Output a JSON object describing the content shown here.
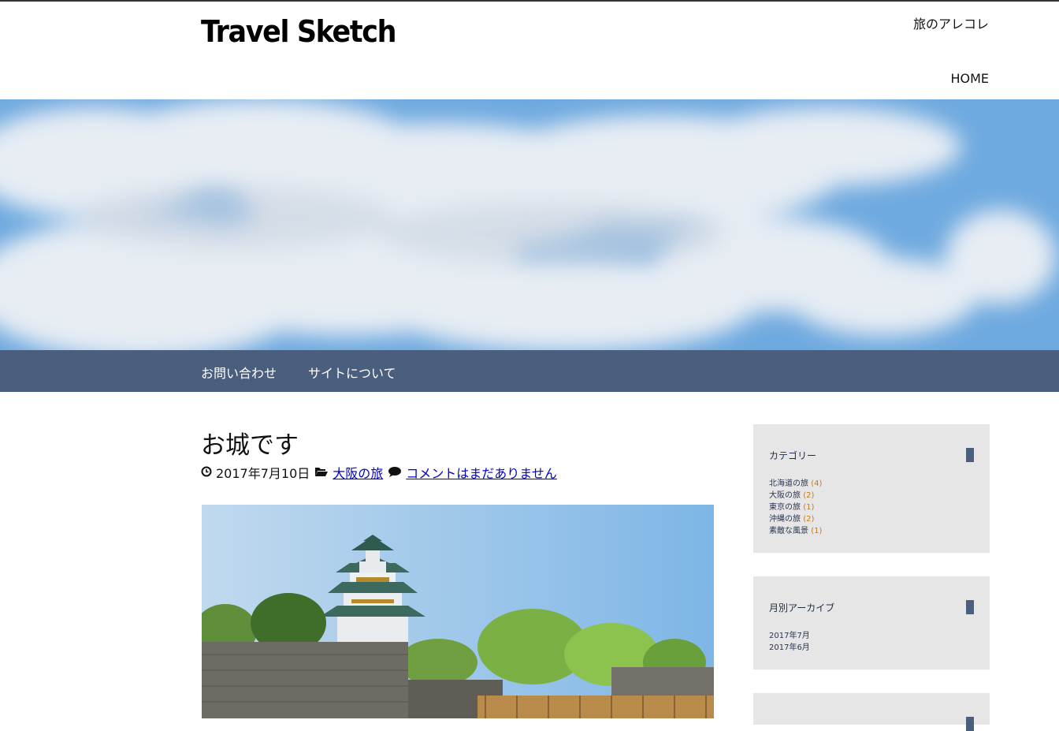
{
  "header": {
    "site_title": "Travel Sketch",
    "tagline": "旅のアレコレ",
    "home_label": "HOME"
  },
  "nav": {
    "items": [
      {
        "label": "お問い合わせ"
      },
      {
        "label": "サイトについて"
      }
    ]
  },
  "post": {
    "title": "お城です",
    "date": "2017年7月10日",
    "category": "大阪の旅",
    "comments": "コメントはまだありません"
  },
  "sidebar": {
    "categories": {
      "title": "カテゴリー",
      "items": [
        {
          "label": "北海道の旅",
          "count": "(4)"
        },
        {
          "label": "大阪の旅",
          "count": "(2)"
        },
        {
          "label": "東京の旅",
          "count": "(1)"
        },
        {
          "label": "沖縄の旅",
          "count": "(2)"
        },
        {
          "label": "素敵な風景",
          "count": "(1)"
        }
      ]
    },
    "archives": {
      "title": "月別アーカイブ",
      "items": [
        {
          "label": "2017年7月"
        },
        {
          "label": "2017年6月"
        }
      ]
    }
  },
  "icons": {
    "date": "clock-icon",
    "category": "folder-open-icon",
    "comments": "comment-icon"
  },
  "colors": {
    "nav_bar": "#4a5e7e",
    "widget_bg": "#e6e6e6",
    "link": "#0000cc",
    "count": "#c97a1a"
  }
}
